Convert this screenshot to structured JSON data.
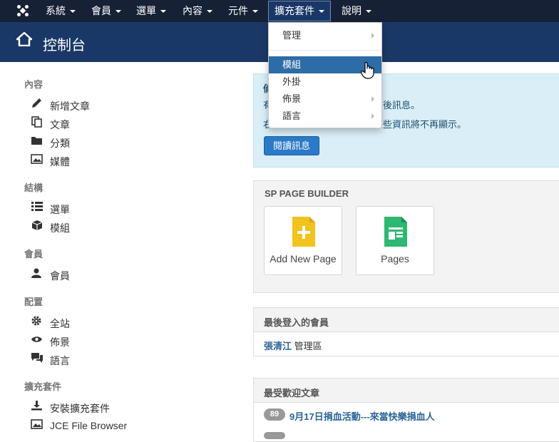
{
  "navbar": {
    "items": [
      {
        "label": "系統"
      },
      {
        "label": "會員"
      },
      {
        "label": "選單"
      },
      {
        "label": "內容"
      },
      {
        "label": "元件"
      },
      {
        "label": "擴充套件"
      },
      {
        "label": "說明"
      }
    ]
  },
  "header": {
    "title": "控制台"
  },
  "sidebar": {
    "sections": [
      {
        "title": "內容",
        "items": [
          {
            "label": "新增文章"
          },
          {
            "label": "文章"
          },
          {
            "label": "分類"
          },
          {
            "label": "媒體"
          }
        ]
      },
      {
        "title": "結構",
        "items": [
          {
            "label": "選單"
          },
          {
            "label": "模組"
          }
        ]
      },
      {
        "title": "會員",
        "items": [
          {
            "label": "會員"
          }
        ]
      },
      {
        "title": "配置",
        "items": [
          {
            "label": "全站"
          },
          {
            "label": "佈景"
          },
          {
            "label": "語言"
          }
        ]
      },
      {
        "title": "擴充套件",
        "items": [
          {
            "label": "安裝擴充套件"
          },
          {
            "label": "JCE File Browser"
          }
        ]
      }
    ]
  },
  "dropdown": {
    "items": [
      {
        "label": "管理"
      },
      {
        "label": "模組"
      },
      {
        "label": "外掛"
      },
      {
        "label": "佈景"
      },
      {
        "label": "語言"
      }
    ]
  },
  "message_panel": {
    "line1_left": "有",
    "line1_right": "後訊息。",
    "line2_left": "右",
    "line2_right": "些資訊將不再顯示。",
    "heading_fragment": "倘",
    "button": "閱讀訊息"
  },
  "sp_page_builder": {
    "title": "SP PAGE BUILDER",
    "cards": [
      {
        "label": "Add New Page"
      },
      {
        "label": "Pages"
      }
    ],
    "colors": {
      "add": "#f2c31f",
      "pages": "#2eb872"
    }
  },
  "last_login": {
    "title": "最後登入的會員",
    "user_name": "張清江",
    "user_area": "管理區"
  },
  "popular": {
    "title": "最受歡迎文章",
    "items": [
      {
        "hits": "89",
        "title": "9月17日捐血活動---來當快樂捐血人"
      }
    ]
  }
}
